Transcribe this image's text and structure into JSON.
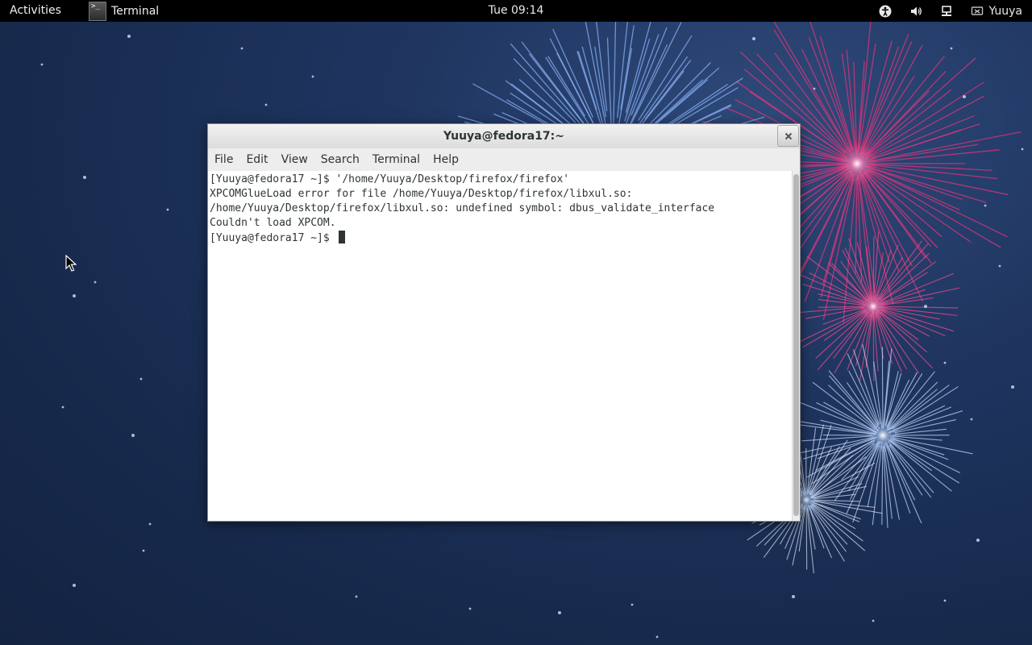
{
  "topbar": {
    "activities_label": "Activities",
    "app_name": "Terminal",
    "app_icon_glyph": ">_",
    "clock": "Tue 09:14",
    "tray_icons": [
      "accessibility-icon",
      "volume-icon",
      "network-icon"
    ],
    "user_name": "Yuuya"
  },
  "window": {
    "title": "Yuuya@fedora17:~",
    "menus": [
      "File",
      "Edit",
      "View",
      "Search",
      "Terminal",
      "Help"
    ]
  },
  "terminal": {
    "lines": [
      "[Yuuya@fedora17 ~]$ '/home/Yuuya/Desktop/firefox/firefox'",
      "XPCOMGlueLoad error for file /home/Yuuya/Desktop/firefox/libxul.so:",
      "/home/Yuuya/Desktop/firefox/libxul.so: undefined symbol: dbus_validate_interface",
      "Couldn't load XPCOM.",
      "[Yuuya@fedora17 ~]$ "
    ]
  },
  "colors": {
    "topbar_bg": "#000000",
    "wallpaper_base": "#1f3560",
    "firework_pink": "#e0357a",
    "firework_blue": "#8fb8ff",
    "terminal_text": "#2e3436"
  }
}
